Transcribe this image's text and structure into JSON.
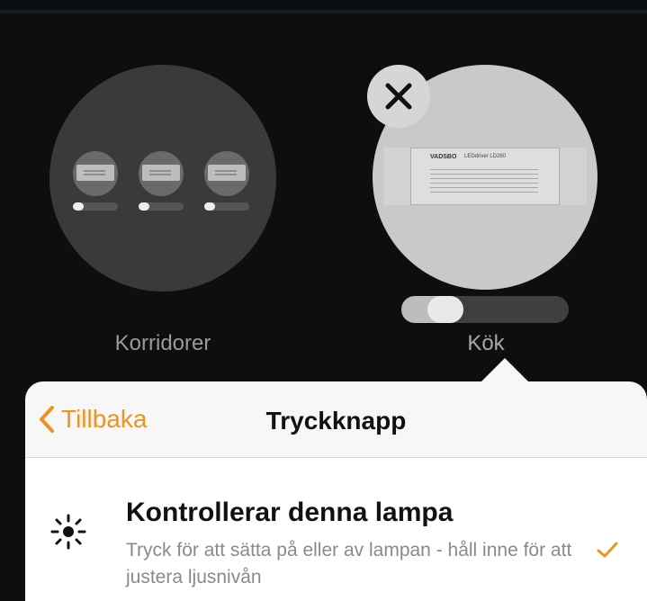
{
  "rooms": [
    {
      "name": "Korridorer",
      "lamp_count": 3
    },
    {
      "name": "Kök",
      "device_brand": "VADSBO",
      "device_model": "LEDdriver LD260"
    }
  ],
  "kok_brightness": 0.2,
  "popover": {
    "back_label": "Tillbaka",
    "title": "Tryckknapp",
    "option": {
      "icon": "sun-icon",
      "title": "Kontrollerar denna lampa",
      "description": "Tryck för att sätta på eller av lampan - håll inne för att justera ljusnivån",
      "selected": true
    }
  },
  "colors": {
    "accent": "#f0921e",
    "background": "#000000",
    "sheet": "#f7f7f7"
  }
}
